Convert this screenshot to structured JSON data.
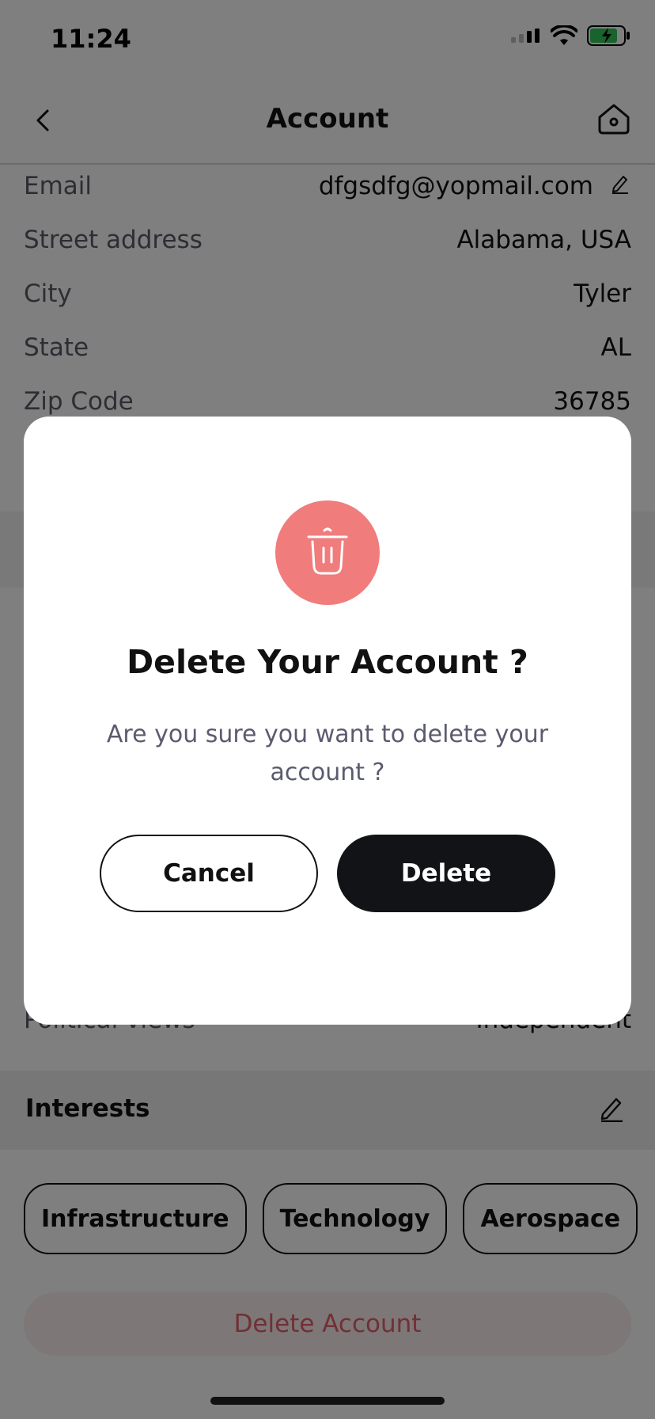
{
  "status_bar": {
    "time": "11:24"
  },
  "nav": {
    "title": "Account"
  },
  "fields": [
    {
      "label": "Email",
      "value": "dfgsdfg@yopmail.com"
    },
    {
      "label": "Street address",
      "value": "Alabama, USA"
    },
    {
      "label": "City",
      "value": "Tyler"
    },
    {
      "label": "State",
      "value": "AL"
    },
    {
      "label": "Zip Code",
      "value": "36785"
    }
  ],
  "background_partial": {
    "political_views_label": "Political views",
    "political_views_value": "Independent"
  },
  "interests": {
    "title": "Interests",
    "chips": [
      "Infrastructure",
      "Technology",
      "Aerospace"
    ]
  },
  "delete_account_label": "Delete Account",
  "modal": {
    "title": "Delete Your Account ?",
    "message": "Are you sure you want to delete your account ?",
    "cancel_label": "Cancel",
    "delete_label": "Delete",
    "icon": "trash-icon",
    "icon_color": "#f07c7c"
  },
  "colors": {
    "primary_button": "#121316",
    "danger_text": "#e0606a",
    "overlay": "rgba(0,0,0,0.5)"
  }
}
